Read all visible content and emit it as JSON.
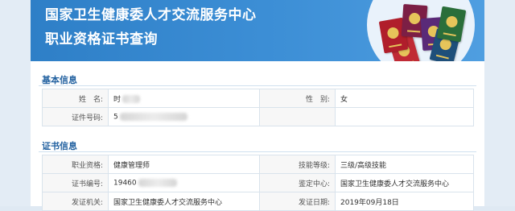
{
  "header": {
    "title_line1": "国家卫生健康委人才交流服务中心",
    "title_line2": "职业资格证书查询"
  },
  "basic_info": {
    "section_title": "基本信息",
    "name_label": "姓　名:",
    "name_value": "时",
    "gender_label": "性　别:",
    "gender_value": "女",
    "id_label": "证件号码:",
    "id_value": "5"
  },
  "cert_info": {
    "section_title": "证书信息",
    "occupation_label": "职业资格:",
    "occupation_value": "健康管理师",
    "level_label": "技能等级:",
    "level_value": "三级/高级技能",
    "cert_no_label": "证书编号:",
    "cert_no_value": "19460",
    "appraisal_label": "鉴定中心:",
    "appraisal_value": "国家卫生健康委人才交流服务中心",
    "issuer_label": "发证机关:",
    "issuer_value": "国家卫生健康委人才交流服务中心",
    "issue_date_label": "发证日期:",
    "issue_date_value": "2019年09月18日"
  },
  "colors": {
    "banner": "#3d8fd6",
    "section_title": "#1f5f9f",
    "page_bg": "#dfe9f3"
  }
}
